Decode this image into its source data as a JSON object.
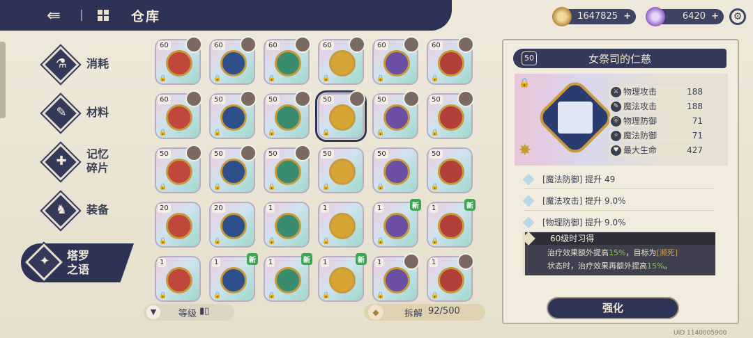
{
  "header": {
    "title": "仓库"
  },
  "currency": {
    "gold": "1647825",
    "gem": "6420",
    "plus": "+"
  },
  "sidebar": {
    "items": [
      {
        "label": "消耗"
      },
      {
        "label": "材料"
      },
      {
        "label_line1": "记忆",
        "label_line2": "碎片"
      },
      {
        "label": "装备"
      },
      {
        "label_line1": "塔罗",
        "label_line2": "之语"
      }
    ]
  },
  "grid": {
    "rows": [
      [
        {
          "lvl": "60"
        },
        {
          "lvl": "60"
        },
        {
          "lvl": "60"
        },
        {
          "lvl": "60"
        },
        {
          "lvl": "60"
        },
        {
          "lvl": "60"
        }
      ],
      [
        {
          "lvl": "60"
        },
        {
          "lvl": "50"
        },
        {
          "lvl": "50"
        },
        {
          "lvl": "50"
        },
        {
          "lvl": "50"
        },
        {
          "lvl": "50"
        }
      ],
      [
        {
          "lvl": "50"
        },
        {
          "lvl": "50"
        },
        {
          "lvl": "50"
        },
        {
          "lvl": "50"
        },
        {
          "lvl": "50"
        },
        {
          "lvl": "50"
        }
      ],
      [
        {
          "lvl": "20"
        },
        {
          "lvl": "20"
        },
        {
          "lvl": "1"
        },
        {
          "lvl": "1"
        },
        {
          "lvl": "1",
          "new": "新"
        },
        {
          "lvl": "1",
          "new": "新"
        }
      ],
      [
        {
          "lvl": "1"
        },
        {
          "lvl": "1",
          "new": "新"
        },
        {
          "lvl": "1",
          "new": "新"
        },
        {
          "lvl": "1",
          "new": "新"
        },
        {
          "lvl": "1"
        },
        {
          "lvl": "1"
        }
      ]
    ]
  },
  "footer": {
    "filter_label": "等级",
    "dismantle_label": "拆解",
    "dismantle_count": "92/500"
  },
  "detail": {
    "level": "50",
    "name": "女祭司的仁慈",
    "stats": [
      {
        "name": "物理攻击",
        "value": "188"
      },
      {
        "name": "魔法攻击",
        "value": "188"
      },
      {
        "name": "物理防御",
        "value": "71"
      },
      {
        "name": "魔法防御",
        "value": "71"
      },
      {
        "name": "最大生命",
        "value": "427"
      }
    ],
    "effects": [
      "[魔法防御] 提升 49",
      "[魔法攻击] 提升 9.0%",
      "[物理防御] 提升 9.0%"
    ],
    "skill": {
      "title": "60级时习得",
      "line1a": "治疗效果额外提高",
      "line1b": "15%",
      "line1c": "，目标为",
      "line1d": "[濒死]",
      "line2a": "状态时，治疗效果再额外提高",
      "line2b": "15%",
      "line2c": "。"
    },
    "enhance_label": "强化"
  },
  "uid": "UID 1140005900",
  "colors": {
    "navy": "#2d3354",
    "gold": "#c79a3a",
    "green": "#3fa357"
  }
}
